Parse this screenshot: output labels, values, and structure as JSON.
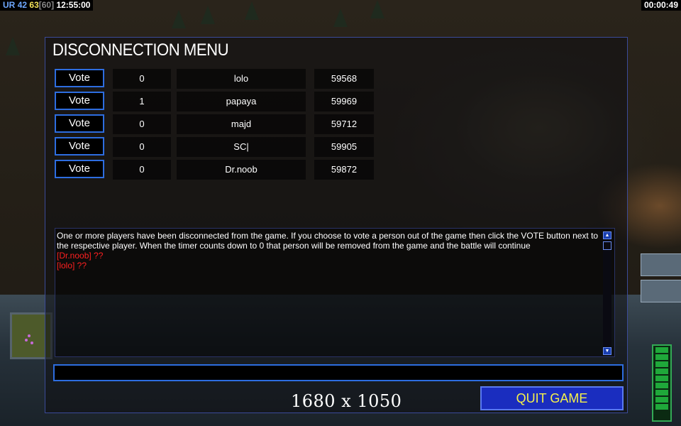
{
  "hud": {
    "ur_label": "UR",
    "ur_value": "42",
    "fps": "63",
    "fps_cap": "[60]",
    "clock": "12:55:00",
    "game_timer": "00:00:49"
  },
  "dialog": {
    "title": "DISCONNECTION MENU",
    "vote_label": "Vote",
    "players": [
      {
        "votes": "0",
        "name": "lolo",
        "ping": "59568"
      },
      {
        "votes": "1",
        "name": "papaya",
        "ping": "59969"
      },
      {
        "votes": "0",
        "name": "majd",
        "ping": "59712"
      },
      {
        "votes": "0",
        "name": "SC|",
        "ping": "59905"
      },
      {
        "votes": "0",
        "name": "Dr.noob",
        "ping": "59872"
      }
    ],
    "messages": {
      "info": "One or more players have been disconnected from the game. If you choose to vote a person out of the game then click the VOTE button next to the respective player. When the timer counts down to 0 that person will be removed from the game and the battle will continue",
      "lines": [
        "[Dr.noob] ??",
        "[lolo] ??"
      ]
    },
    "chat_value": "",
    "quit_label": "QUIT GAME"
  },
  "overlay": {
    "resolution": "1680 x 1050"
  },
  "colors": {
    "accent_blue": "#2d6de0",
    "quit_text": "#f4f14a",
    "alert_red": "#ff2020"
  }
}
